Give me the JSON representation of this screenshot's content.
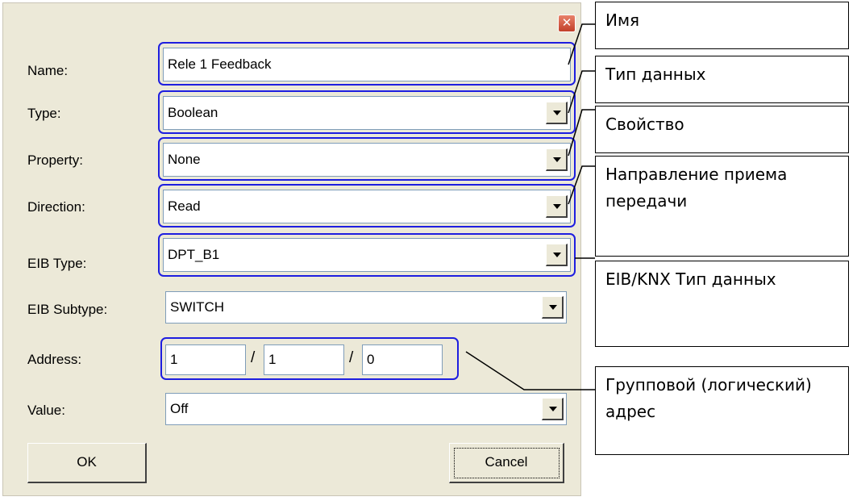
{
  "dialog": {
    "close_glyph": "✕",
    "fields": {
      "name": {
        "label": "Name:",
        "value": "Rele 1 Feedback"
      },
      "type": {
        "label": "Type:",
        "value": "Boolean"
      },
      "property": {
        "label": "Property:",
        "value": "None"
      },
      "direction": {
        "label": "Direction:",
        "value": "Read"
      },
      "eib_type": {
        "label": "EIB Type:",
        "value": "DPT_B1"
      },
      "eib_subtype": {
        "label": "EIB Subtype:",
        "value": "SWITCH"
      },
      "address": {
        "label": "Address:",
        "main": "1",
        "middle": "1",
        "sub": "0",
        "separator": "/"
      },
      "value": {
        "label": "Value:",
        "value": "Off"
      }
    },
    "buttons": {
      "ok": "OK",
      "cancel": "Cancel"
    }
  },
  "callouts": {
    "name": "Имя",
    "type": "Тип данных",
    "property": "Свойство",
    "direction": "Направление приема передачи",
    "eib_type": "EIB/KNX Тип данных",
    "address": "Групповой (логический) адрес"
  },
  "colors": {
    "dialog_bg": "#ece9d8",
    "highlight": "#1e1ee0",
    "field_border": "#7f9db9",
    "close_button": "#c2402a"
  }
}
